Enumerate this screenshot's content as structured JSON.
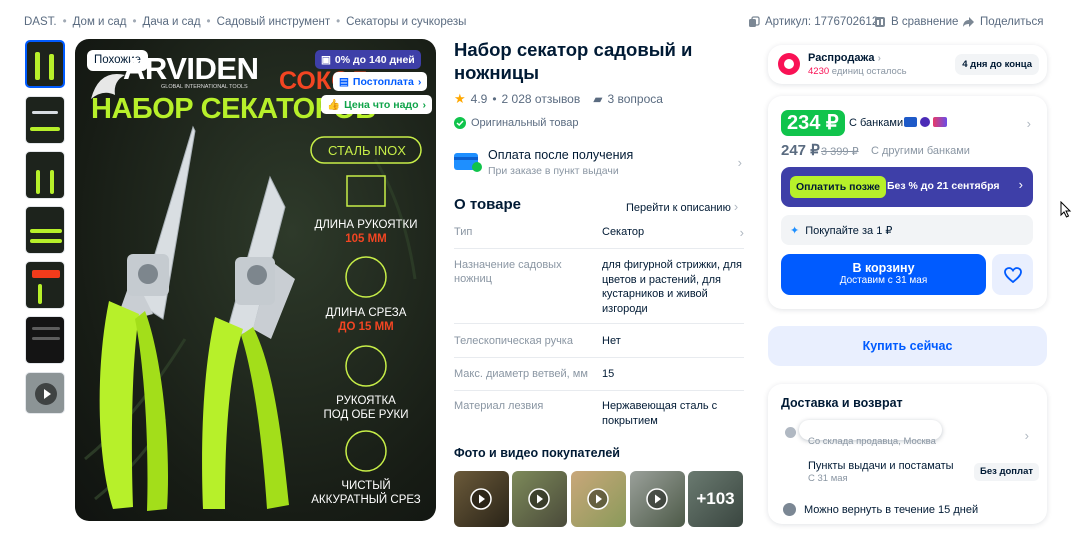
{
  "breadcrumb": [
    "DAST.",
    "Дом и сад",
    "Дача и сад",
    "Садовый инструмент",
    "Секаторы и сучкорезы"
  ],
  "header": {
    "article_label": "Артикул: 1776702612",
    "compare_label": "В сравнение",
    "share_label": "Поделиться"
  },
  "image": {
    "similar_label": "Похожие",
    "brand": "ARVIDEN",
    "brand_sub": "GLOBAL INTERNATIONAL TOOLS",
    "promo_top": "СОКОЛ",
    "promo_title": "НАБОР СЕКАТОРОВ",
    "steel": "СТАЛЬ INOX",
    "f1": "ДЛИНА РУКОЯТКИ",
    "f1v": "105 ММ",
    "f2": "ДЛИНА СРЕЗА",
    "f2v": "ДО 15 ММ",
    "f3a": "РУКОЯТКА",
    "f3b": "ПОД ОБЕ РУКИ",
    "f4a": "ЧИСТЫЙ",
    "f4b": "АККУРАТНЫЙ СРЕЗ",
    "badges": [
      "0% до 140 дней",
      "Постоплата",
      "Цена что надо"
    ]
  },
  "product": {
    "title": "Набор секатор садовый и ножницы",
    "rating": "4.9",
    "reviews": "2 028 отзывов",
    "questions": "3 вопроса",
    "original": "Оригинальный товар"
  },
  "payment": {
    "title": "Оплата после получения",
    "sub": "При заказе в пункт выдачи"
  },
  "about": {
    "title": "О товаре",
    "link": "Перейти к описанию",
    "rows": [
      {
        "k": "Тип",
        "v": "Секатор"
      },
      {
        "k": "Назначение садовых ножниц",
        "v": "для фигурной стрижки, для цветов и растений, для кустарников и живой изгороди"
      },
      {
        "k": "Телескопическая ручка",
        "v": "Нет"
      },
      {
        "k": "Макс. диаметр ветвей, мм",
        "v": "15"
      },
      {
        "k": "Материал лезвия",
        "v": "Нержавеющая сталь с покрытием"
      }
    ]
  },
  "photos": {
    "title": "Фото и видео покупателей",
    "more": "+103"
  },
  "sale": {
    "title": "Распродажа",
    "left": "4230",
    "left_suffix": "единиц осталось",
    "deadline": "4 дня до конца"
  },
  "price": {
    "bank_price": "234 ₽",
    "with_banks": "С банками",
    "price": "247 ₽",
    "old_price": "3 399 ₽",
    "other_banks": "С другими банками"
  },
  "later": {
    "button": "Оплатить позже",
    "text": "Без % до 21 сентября"
  },
  "buy_for": "Покупайте за 1 ₽",
  "cart": {
    "label": "В корзину",
    "sub": "Доставим с 31 мая"
  },
  "buy_now": "Купить сейчас",
  "delivery": {
    "title": "Доставка и возврат",
    "warehouse": "Со склада продавца, Москва",
    "points": "Пункты выдачи и постаматы",
    "points_date": "С 31 мая",
    "points_price": "Без доплат",
    "return": "Можно вернуть в течение 15 дней"
  },
  "colors": {
    "accent": "#005bff",
    "green": "#10c44c",
    "purple": "#3e3fa8",
    "lime": "#b7f02a",
    "pink": "#f91155"
  }
}
